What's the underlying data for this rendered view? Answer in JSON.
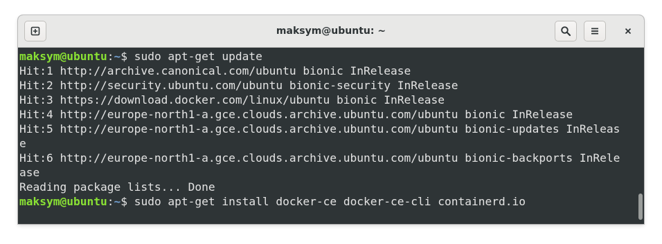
{
  "window": {
    "title": "maksym@ubuntu: ~"
  },
  "headerbar": {
    "new_tab_icon": "new-tab-icon",
    "search_icon": "search-icon",
    "menu_icon": "hamburger-menu-icon",
    "close_icon": "close-icon"
  },
  "colors": {
    "prompt_user": "#8ae234",
    "prompt_path": "#729fcf",
    "text": "#e4e4e4",
    "background": "#2e3436"
  },
  "terminal": {
    "prompt1": {
      "user": "maksym@ubuntu",
      "colon": ":",
      "path": "~",
      "dollar": "$ ",
      "command": "sudo apt-get update"
    },
    "lines": [
      "Hit:1 http://archive.canonical.com/ubuntu bionic InRelease",
      "Hit:2 http://security.ubuntu.com/ubuntu bionic-security InRelease",
      "Hit:3 https://download.docker.com/linux/ubuntu bionic InRelease",
      "Hit:4 http://europe-north1-a.gce.clouds.archive.ubuntu.com/ubuntu bionic InRelease",
      "Hit:5 http://europe-north1-a.gce.clouds.archive.ubuntu.com/ubuntu bionic-updates InReleas",
      "e",
      "Hit:6 http://europe-north1-a.gce.clouds.archive.ubuntu.com/ubuntu bionic-backports InRele",
      "ase",
      "Reading package lists... Done"
    ],
    "prompt2": {
      "user": "maksym@ubuntu",
      "colon": ":",
      "path": "~",
      "dollar": "$ ",
      "command": "sudo apt-get install docker-ce docker-ce-cli containerd.io"
    }
  }
}
